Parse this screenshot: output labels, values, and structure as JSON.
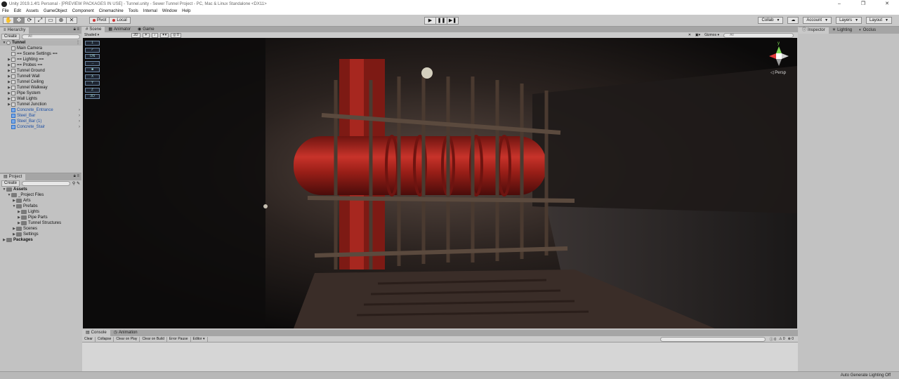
{
  "window": {
    "title": "Unity 2019.1.4f1 Personal - [PREVIEW PACKAGES IN USE] - Tunnel.unity - Sewer Tunnel Project - PC, Mac & Linux Standalone <DX11>",
    "minimize": "–",
    "maximize": "❐",
    "close": "✕"
  },
  "menu": [
    "File",
    "Edit",
    "Assets",
    "GameObject",
    "Component",
    "Cinemachine",
    "Tools",
    "Internal",
    "Window",
    "Help"
  ],
  "toolbar": {
    "tools": [
      "hand-tool-icon",
      "move-tool-icon",
      "rotate-tool-icon",
      "scale-tool-icon",
      "rect-tool-icon",
      "transform-tool-icon",
      "custom-tool-icon"
    ],
    "tool_glyphs": [
      "✋",
      "✥",
      "⟳",
      "⤢",
      "▭",
      "⊕",
      "✕"
    ],
    "pivot_label": "Pivot",
    "local_label": "Local",
    "play_glyph": "▶",
    "pause_glyph": "❚❚",
    "step_glyph": "▶❚",
    "collab_label": "Collab",
    "cloud_glyph": "☁",
    "account_label": "Account",
    "layers_label": "Layers",
    "layout_label": "Layout"
  },
  "hierarchy": {
    "tab_label": "Hierarchy",
    "create_label": "Create",
    "search_placeholder": "All",
    "scene_name": "Tunnel",
    "items": [
      {
        "label": "Main Camera",
        "prefab": false,
        "expandable": false
      },
      {
        "label": "== Scene Settings ==",
        "prefab": false,
        "expandable": false
      },
      {
        "label": "== Lighting ==",
        "prefab": false,
        "expandable": true
      },
      {
        "label": "== Probes ==",
        "prefab": false,
        "expandable": true
      },
      {
        "label": "Tunnel Ground",
        "prefab": false,
        "expandable": true
      },
      {
        "label": "Tunnell Wall",
        "prefab": false,
        "expandable": true
      },
      {
        "label": "Tunnel Ceiling",
        "prefab": false,
        "expandable": true
      },
      {
        "label": "Tunnel Walkway",
        "prefab": false,
        "expandable": true
      },
      {
        "label": "Pipe System",
        "prefab": false,
        "expandable": true
      },
      {
        "label": "Wall Lights",
        "prefab": false,
        "expandable": true
      },
      {
        "label": "Tunnel Junction",
        "prefab": false,
        "expandable": true
      },
      {
        "label": "Concrete_Entrance",
        "prefab": true,
        "expandable": false
      },
      {
        "label": "Steel_Bar",
        "prefab": true,
        "expandable": false
      },
      {
        "label": "Steel_Bar (1)",
        "prefab": true,
        "expandable": false
      },
      {
        "label": "Concrete_Stair",
        "prefab": true,
        "expandable": false
      }
    ]
  },
  "project": {
    "tab_label": "Project",
    "create_label": "Create",
    "tree": [
      {
        "label": "Assets",
        "depth": 0,
        "bold": true,
        "arrow": "▼"
      },
      {
        "label": "_Project Files",
        "depth": 1,
        "bold": false,
        "arrow": "▼"
      },
      {
        "label": "Arts",
        "depth": 2,
        "bold": false,
        "arrow": "▶"
      },
      {
        "label": "Prefabs",
        "depth": 2,
        "bold": false,
        "arrow": "▼"
      },
      {
        "label": "Lights",
        "depth": 3,
        "bold": false,
        "arrow": "▶"
      },
      {
        "label": "Pipe Parts",
        "depth": 3,
        "bold": false,
        "arrow": "▶"
      },
      {
        "label": "Tunnel Structures",
        "depth": 3,
        "bold": false,
        "arrow": "▶"
      },
      {
        "label": "Scenes",
        "depth": 2,
        "bold": false,
        "arrow": "▶"
      },
      {
        "label": "Settings",
        "depth": 2,
        "bold": false,
        "arrow": "▶"
      },
      {
        "label": "Packages",
        "depth": 0,
        "bold": true,
        "arrow": "▶"
      }
    ]
  },
  "scene": {
    "tabs": [
      "Scene",
      "Animator",
      "Game"
    ],
    "shading_mode": "Shaded",
    "mode_2d": "2D",
    "gizmos_label": "Gizmos",
    "search_placeholder": "All",
    "persp_label": "Persp",
    "gizmo_axis_y": "y",
    "overlay_buttons": [
      "1",
      "✓",
      "ON",
      "→",
      "■",
      "X",
      "Y",
      "Z",
      "3D"
    ]
  },
  "inspector": {
    "tabs": [
      "Inspector",
      "Lighting",
      "Occlus"
    ]
  },
  "console": {
    "tabs": [
      "Console",
      "Animation"
    ],
    "buttons": [
      "Clear",
      "Collapse",
      "Clear on Play",
      "Clear on Build",
      "Error Pause",
      "Editor"
    ],
    "log_count": "0",
    "warn_count": "0",
    "error_count": "0"
  },
  "status": {
    "text": "Auto Generate Lighting Off"
  },
  "colors": {
    "editor_bg": "#c2c2c2",
    "prefab_blue": "#1d4fa3",
    "pipe_red": "#a5221c"
  }
}
